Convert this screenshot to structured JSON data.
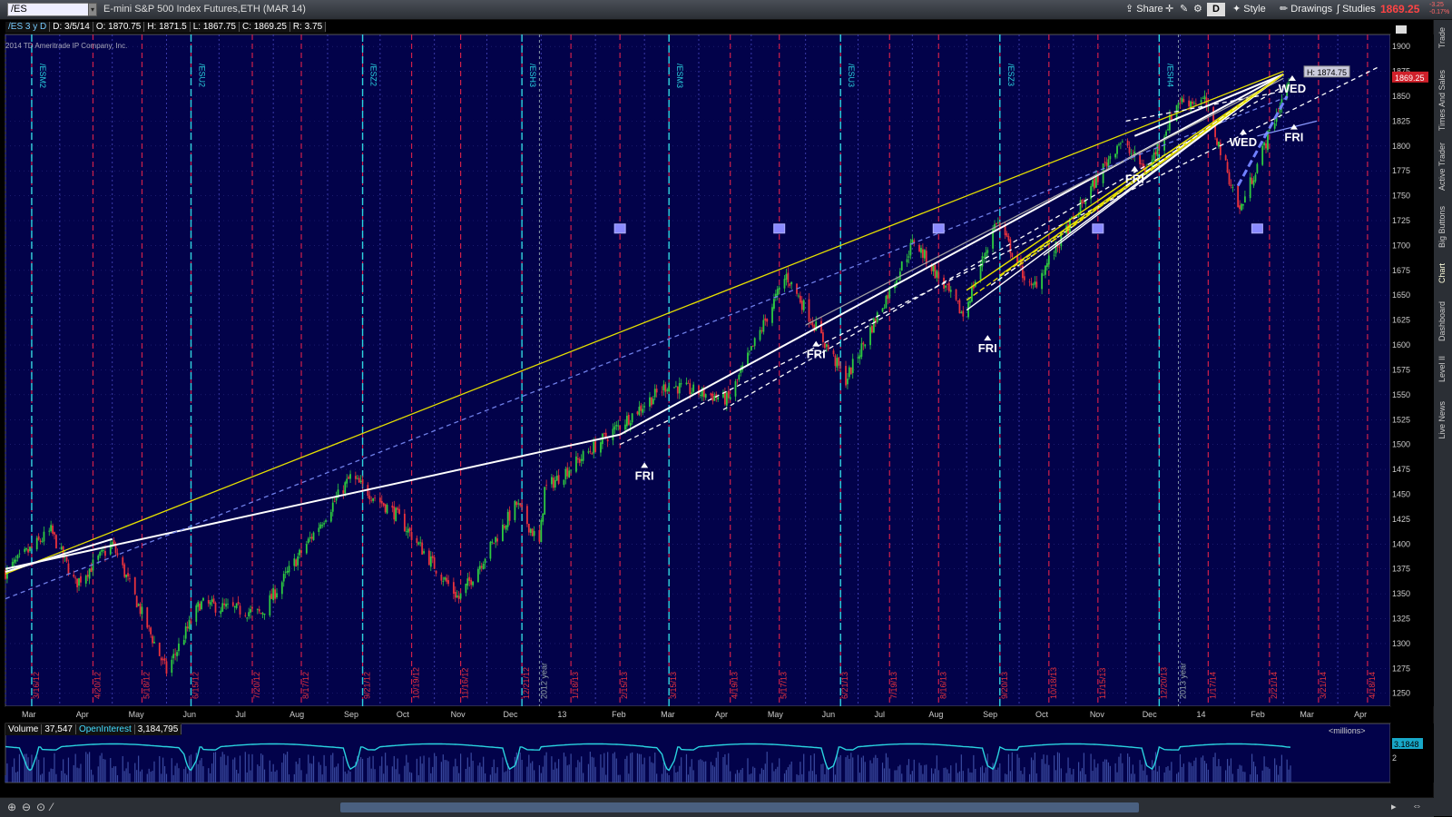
{
  "toolbar": {
    "symbol": "/ES",
    "description": "E-mini S&P 500 Index Futures,ETH (MAR 14)",
    "share": "Share",
    "style": "Style",
    "drawings": "Drawings",
    "studies": "Studies",
    "d_badge": "D",
    "last_price": "1869.25",
    "change_1": "-3.25",
    "change_2": "-0.17%",
    "dropdown_glyph": "▾"
  },
  "side_tabs": [
    "Trade",
    "Times And Sales",
    "Active Trader",
    "Big Buttons",
    "Chart",
    "Dashboard",
    "Level II",
    "Live News"
  ],
  "colors": {
    "bg": "#02024a",
    "up": "#2ecc40",
    "down": "#e8323c",
    "cyan": "#2ad4e0",
    "yellow": "#e6e000",
    "white": "#ffffff",
    "gray": "#a0a0a0"
  },
  "legend": {
    "study": "/ES 3 y D",
    "date": "D: 3/5/14",
    "open": "O: 1870.75",
    "high": "H: 1871.5",
    "low": "L: 1867.75",
    "close": "C: 1869.25",
    "range": "R: 3.75"
  },
  "copyright": "2014 TD Ameritrade IP Company, Inc.",
  "chart_data": {
    "type": "candlestick",
    "ylim": [
      1237,
      1912
    ],
    "y_ticks": [
      1250,
      1275,
      1300,
      1325,
      1350,
      1375,
      1400,
      1425,
      1450,
      1475,
      1500,
      1525,
      1550,
      1575,
      1600,
      1625,
      1650,
      1675,
      1700,
      1725,
      1750,
      1775,
      1800,
      1825,
      1850,
      1875,
      1900
    ],
    "x_ticks": [
      "Mar",
      "Apr",
      "May",
      "Jun",
      "Jul",
      "Aug",
      "Sep",
      "Oct",
      "Nov",
      "Dec",
      "13",
      "Feb",
      "Mar",
      "Apr",
      "May",
      "Jun",
      "Jul",
      "Aug",
      "Sep",
      "Oct",
      "Nov",
      "Dec",
      "14",
      "Feb",
      "Mar",
      "Apr"
    ],
    "high_label": "H: 1874.75",
    "last_label": "1869.25",
    "contract_expiries": [
      "/ESM2",
      "/ESU2",
      "/ESZ2",
      "/ESH3",
      "/ESM3",
      "/ESU3",
      "/ESZ3",
      "/ESH4"
    ],
    "option_dates": [
      "3/16/12",
      "4/20/12",
      "5/18/12",
      "6/15/12",
      "7/20/12",
      "8/17/12",
      "9/21/12",
      "10/19/12",
      "11/16/12",
      "12/21/12",
      "1/18/13",
      "2/15/13",
      "3/15/13",
      "4/19/13",
      "5/17/13",
      "6/21/13",
      "7/19/13",
      "8/16/13",
      "9/20/13",
      "10/18/13",
      "11/15/13",
      "12/20/13",
      "1/17/14",
      "2/21/14",
      "3/21/14",
      "4/18/14"
    ],
    "year_labels": [
      "2012 year",
      "2013 year"
    ],
    "path_points": [
      {
        "d": "2012-03-01",
        "c": 1372
      },
      {
        "d": "2012-03-27",
        "c": 1413
      },
      {
        "d": "2012-04-10",
        "c": 1360
      },
      {
        "d": "2012-05-01",
        "c": 1400
      },
      {
        "d": "2012-06-01",
        "c": 1272
      },
      {
        "d": "2012-06-20",
        "c": 1340
      },
      {
        "d": "2012-07-25",
        "c": 1330
      },
      {
        "d": "2012-09-14",
        "c": 1467
      },
      {
        "d": "2012-10-10",
        "c": 1430
      },
      {
        "d": "2012-11-15",
        "c": 1345
      },
      {
        "d": "2012-12-18",
        "c": 1440
      },
      {
        "d": "2012-12-31",
        "c": 1400
      },
      {
        "d": "2013-01-03",
        "c": 1455
      },
      {
        "d": "2013-03-14",
        "c": 1560
      },
      {
        "d": "2013-04-18",
        "c": 1545
      },
      {
        "d": "2013-05-21",
        "c": 1670
      },
      {
        "d": "2013-06-24",
        "c": 1565
      },
      {
        "d": "2013-08-02",
        "c": 1705
      },
      {
        "d": "2013-08-30",
        "c": 1630
      },
      {
        "d": "2013-09-18",
        "c": 1725
      },
      {
        "d": "2013-10-08",
        "c": 1655
      },
      {
        "d": "2013-11-27",
        "c": 1805
      },
      {
        "d": "2013-12-13",
        "c": 1775
      },
      {
        "d": "2013-12-31",
        "c": 1845
      },
      {
        "d": "2014-01-15",
        "c": 1845
      },
      {
        "d": "2014-02-04",
        "c": 1735
      },
      {
        "d": "2014-03-05",
        "c": 1869
      }
    ],
    "open_interest_ylim": [
      0,
      4
    ],
    "open_interest_ticks": [
      2
    ],
    "open_interest_value": "3.1848",
    "annotations": [
      {
        "label": "FRI",
        "d": "2013-03-01",
        "y": 1482
      },
      {
        "label": "FRI",
        "d": "2013-06-07",
        "y": 1604
      },
      {
        "label": "FRI",
        "d": "2013-09-13",
        "y": 1610
      },
      {
        "label": "FRI",
        "d": "2013-12-06",
        "y": 1780
      },
      {
        "label": "WED",
        "d": "2014-02-06",
        "y": 1817
      },
      {
        "label": "WED",
        "d": "2014-03-06",
        "y": 1871
      },
      {
        "label": "FRI",
        "d": "2014-03-07",
        "y": 1822
      }
    ],
    "trendlines": [
      {
        "color": "yellow",
        "p1": {
          "d": "2012-03-01",
          "y": 1370
        },
        "p2": {
          "d": "2014-03-01",
          "y": 1875
        }
      },
      {
        "color": "white",
        "p1": {
          "d": "2012-03-01",
          "y": 1375
        },
        "p2": {
          "d": "2013-02-15",
          "y": 1510
        }
      },
      {
        "color": "white",
        "p1": {
          "d": "2013-02-15",
          "y": 1510
        },
        "p2": {
          "d": "2014-03-01",
          "y": 1872
        }
      },
      {
        "color": "gray",
        "p1": {
          "d": "2013-06-01",
          "y": 1620
        },
        "p2": {
          "d": "2014-03-01",
          "y": 1868
        }
      },
      {
        "color": "white",
        "p1": {
          "d": "2013-12-06",
          "y": 1810
        },
        "p2": {
          "d": "2014-03-01",
          "y": 1872
        }
      },
      {
        "color": "white",
        "dashed": true,
        "p1": {
          "d": "2013-02-15",
          "y": 1500
        },
        "p2": {
          "d": "2014-04-25",
          "y": 1880
        }
      },
      {
        "color": "white",
        "dashed": true,
        "p1": {
          "d": "2013-04-15",
          "y": 1535
        },
        "p2": {
          "d": "2014-03-01",
          "y": 1860
        }
      },
      {
        "color": "blue",
        "dashed": true,
        "p1": {
          "d": "2012-03-01",
          "y": 1345
        },
        "p2": {
          "d": "2014-03-01",
          "y": 1848
        }
      },
      {
        "color": "white",
        "p1": {
          "d": "2012-03-01",
          "y": 1372
        },
        "p2": {
          "d": "2012-05-01",
          "y": 1405
        }
      },
      {
        "color": "white",
        "dashed": true,
        "p1": {
          "d": "2013-12-01",
          "y": 1825
        },
        "p2": {
          "d": "2014-03-01",
          "y": 1855
        }
      }
    ],
    "fan_origin": {
      "d": "2014-03-01",
      "y": 1872
    },
    "fan_starts": [
      {
        "d": "2013-09-01",
        "y": 1635
      },
      {
        "d": "2013-09-01",
        "y": 1645
      },
      {
        "d": "2013-09-01",
        "y": 1655
      },
      {
        "d": "2013-09-15",
        "y": 1660
      },
      {
        "d": "2013-09-20",
        "y": 1670
      },
      {
        "d": "2013-10-01",
        "y": 1680
      },
      {
        "d": "2013-10-15",
        "y": 1690
      },
      {
        "d": "2013-11-01",
        "y": 1720
      },
      {
        "d": "2013-11-15",
        "y": 1745
      },
      {
        "d": "2013-12-01",
        "y": 1760
      },
      {
        "d": "2013-12-15",
        "y": 1775
      }
    ],
    "blue_markers": [
      {
        "d": "2013-02-15",
        "y": 1717
      },
      {
        "d": "2013-05-17",
        "y": 1717
      },
      {
        "d": "2013-08-16",
        "y": 1717
      },
      {
        "d": "2013-11-15",
        "y": 1717
      },
      {
        "d": "2014-02-14",
        "y": 1717
      }
    ]
  },
  "volume_pane": {
    "volume_label": "Volume",
    "volume_value": "37,547",
    "oi_label": "OpenInterest",
    "oi_value": "3,184,795",
    "units": "<millions>"
  }
}
